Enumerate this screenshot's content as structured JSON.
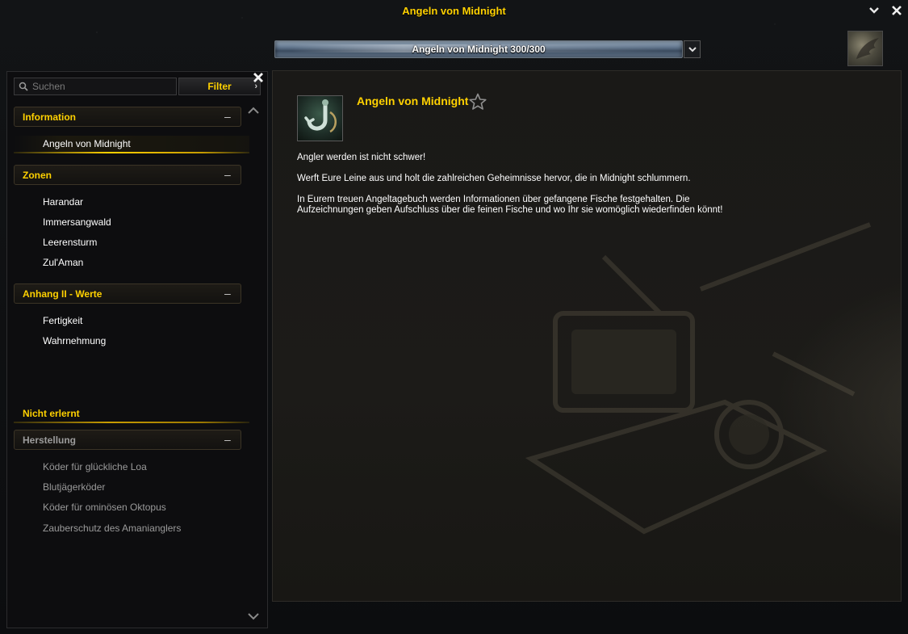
{
  "window": {
    "title": "Angeln von Midnight"
  },
  "skill": {
    "label": "Angeln von Midnight 300/300",
    "current": 300,
    "max": 300
  },
  "search": {
    "placeholder": "Suchen"
  },
  "filter": {
    "label": "Filter"
  },
  "categories": [
    {
      "label": "Information",
      "items": [
        "Angeln von Midnight"
      ],
      "selected": "Angeln von Midnight"
    },
    {
      "label": "Zonen",
      "items": [
        "Harandar",
        "Immersangwald",
        "Leerensturm",
        "Zul'Aman"
      ]
    },
    {
      "label": "Anhang II - Werte",
      "items": [
        "Fertigkeit",
        "Wahrnehmung"
      ]
    }
  ],
  "unlearned": {
    "section_label": "Nicht erlernt",
    "category": {
      "label": "Herstellung",
      "items": [
        "Köder für glückliche Loa",
        "Blutjägerköder",
        "Köder für ominösen Oktopus",
        "Zauberschutz des Amanianglers"
      ]
    }
  },
  "detail": {
    "title": "Angeln von Midnight",
    "paragraphs": [
      "Angler werden ist nicht schwer!",
      "Werft Eure Leine aus und holt die zahlreichen Geheimnisse hervor, die in Midnight schlummern.",
      "In Eurem treuen Angeltagebuch werden Informationen über gefangene Fische festgehalten. Die",
      "Aufzeichnungen geben Aufschluss über die feinen Fische und wo Ihr sie womöglich wiederfinden könnt!"
    ]
  },
  "colors": {
    "accent_gold": "#ffd100",
    "text_white": "#ffffff",
    "text_dim": "#9a9a9a"
  },
  "icons": {
    "collapse": "minus-icon",
    "close": "close-icon",
    "minimize": "chevron-down-icon",
    "favorite": "star-outline-icon",
    "recipe": "fishing-hook-icon"
  }
}
